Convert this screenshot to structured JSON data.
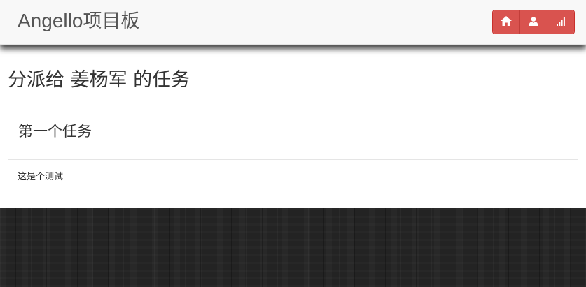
{
  "navbar": {
    "brand_prefix": "Angello",
    "brand_suffix": "项目板",
    "buttons": [
      {
        "icon": "home-icon"
      },
      {
        "icon": "user-icon"
      },
      {
        "icon": "signal-icon"
      }
    ],
    "button_color": "#d9534f"
  },
  "page": {
    "title": "分派给 姜杨军 的任务"
  },
  "task": {
    "title": "第一个任务",
    "description": "这是个测试"
  }
}
